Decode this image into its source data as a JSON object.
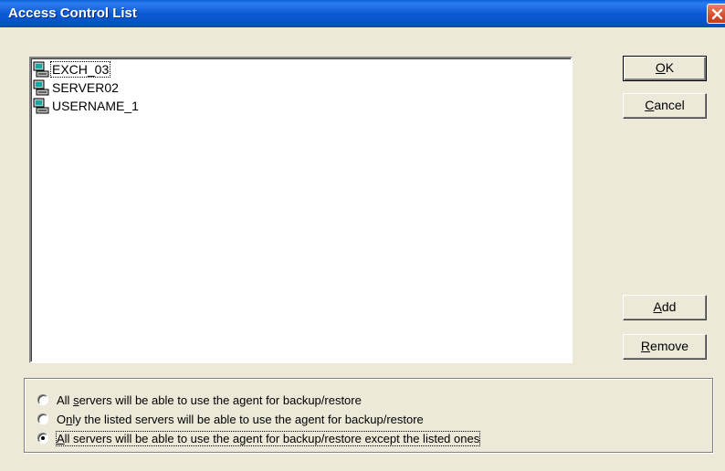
{
  "window": {
    "title": "Access Control List"
  },
  "list": {
    "items": [
      {
        "label": "EXCH_03",
        "icon": "server-computer-icon"
      },
      {
        "label": "SERVER02",
        "icon": "server-computer-icon"
      },
      {
        "label": "USERNAME_1",
        "icon": "server-computer-icon"
      }
    ]
  },
  "buttons": {
    "ok": {
      "accel": "O",
      "rest": "K"
    },
    "cancel": {
      "accel": "C",
      "rest": "ancel"
    },
    "add": {
      "accel": "A",
      "rest": "dd"
    },
    "remove": {
      "accel": "R",
      "rest": "emove"
    }
  },
  "options": [
    {
      "pre": "All ",
      "accel": "s",
      "post": "ervers will be able to use the agent for backup/restore",
      "selected": false
    },
    {
      "pre": "O",
      "accel": "n",
      "post": "ly the listed servers will be able to use the agent for backup/restore",
      "selected": false
    },
    {
      "pre": "",
      "accel": "A",
      "post": "ll servers will be able to use the agent for backup/restore except the listed ones",
      "selected": true
    }
  ],
  "colors": {
    "title_bar": "#0b5ad4",
    "dialog_bg": "#ece9d8",
    "close_button": "#d6522f"
  }
}
